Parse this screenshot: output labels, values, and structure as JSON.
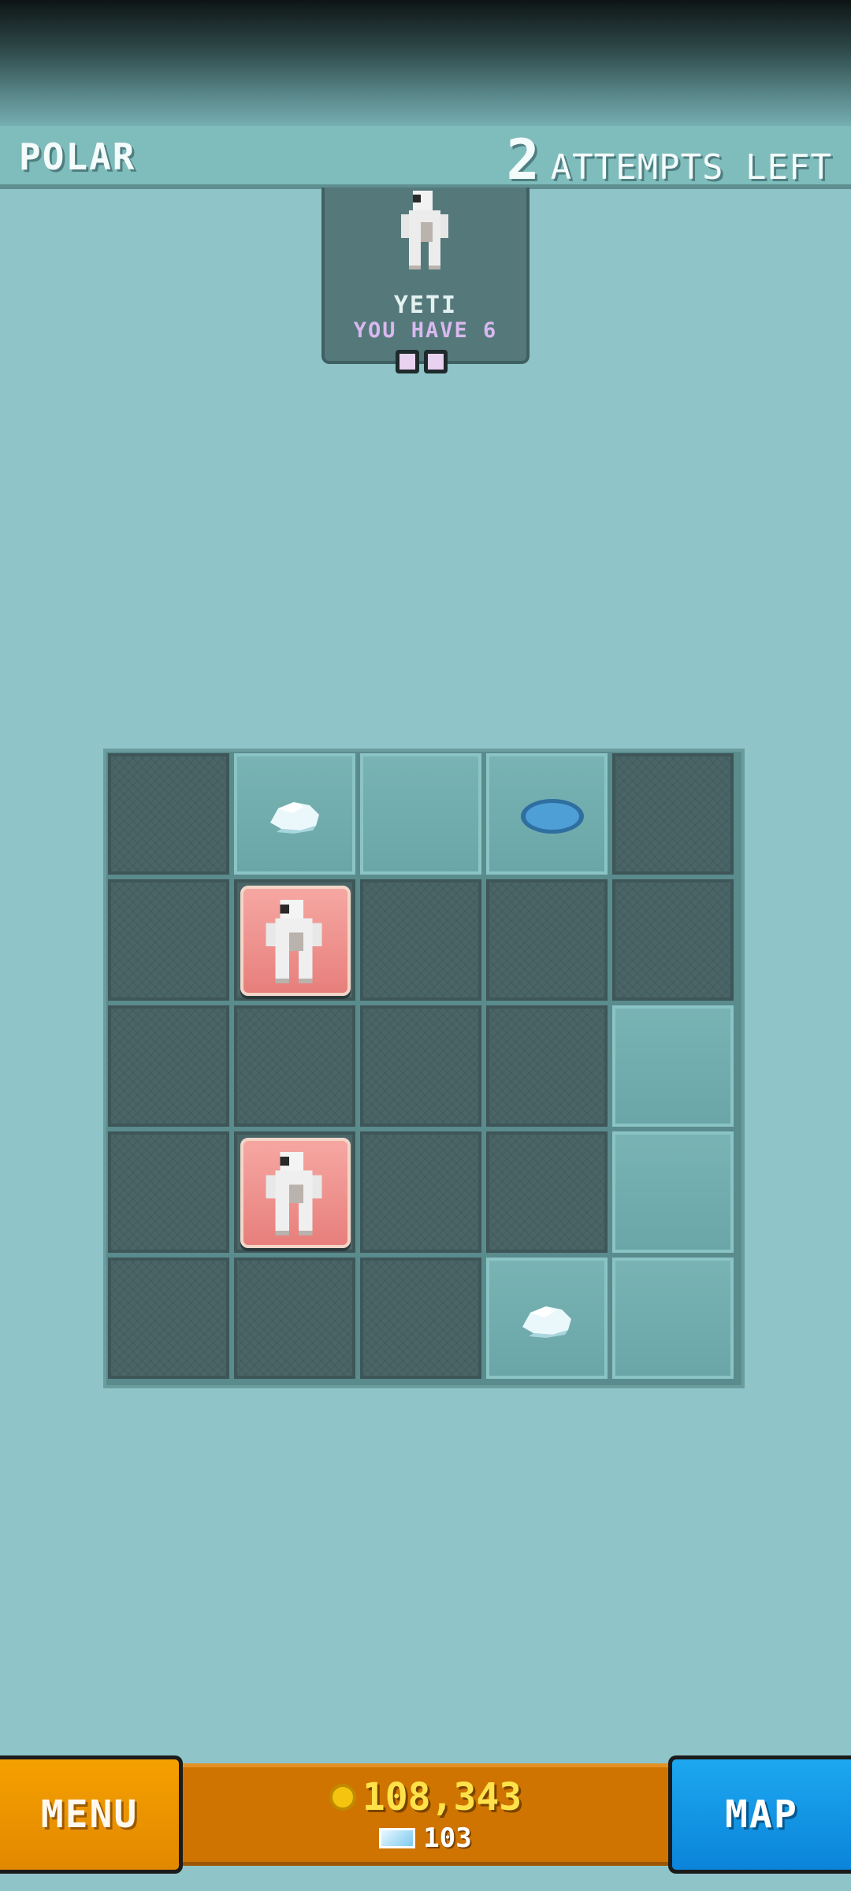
{
  "header": {
    "level_name": "POLAR",
    "attempts_count": "2",
    "attempts_label": "ATTEMPTS LEFT"
  },
  "goal_card": {
    "creature_name": "YETI",
    "you_have": "YOU HAVE 6",
    "creature_icon": "yeti-icon",
    "indicator_count": 2
  },
  "board": {
    "rows": 5,
    "cols": 5,
    "cells": [
      [
        "dark",
        "ice-chunk",
        "light",
        "ice-hole",
        "dark"
      ],
      [
        "dark",
        "yeti",
        "dark",
        "dark",
        "dark"
      ],
      [
        "dark",
        "dark",
        "dark",
        "dark",
        "light"
      ],
      [
        "dark",
        "yeti",
        "dark",
        "dark",
        "light"
      ],
      [
        "dark",
        "dark",
        "dark",
        "ice-chunk",
        "light"
      ]
    ]
  },
  "bottom_bar": {
    "menu_label": "MENU",
    "map_label": "MAP",
    "coins": "108,343",
    "gems": "103",
    "coin_icon": "coin-icon",
    "gem_icon": "gem-icon"
  },
  "colors": {
    "background": "#8fc4c8",
    "menu_button": "#f5a000",
    "map_button": "#1ca8f0",
    "currency_panel": "#cf7400",
    "yeti_tile": "#f6a7a2"
  }
}
